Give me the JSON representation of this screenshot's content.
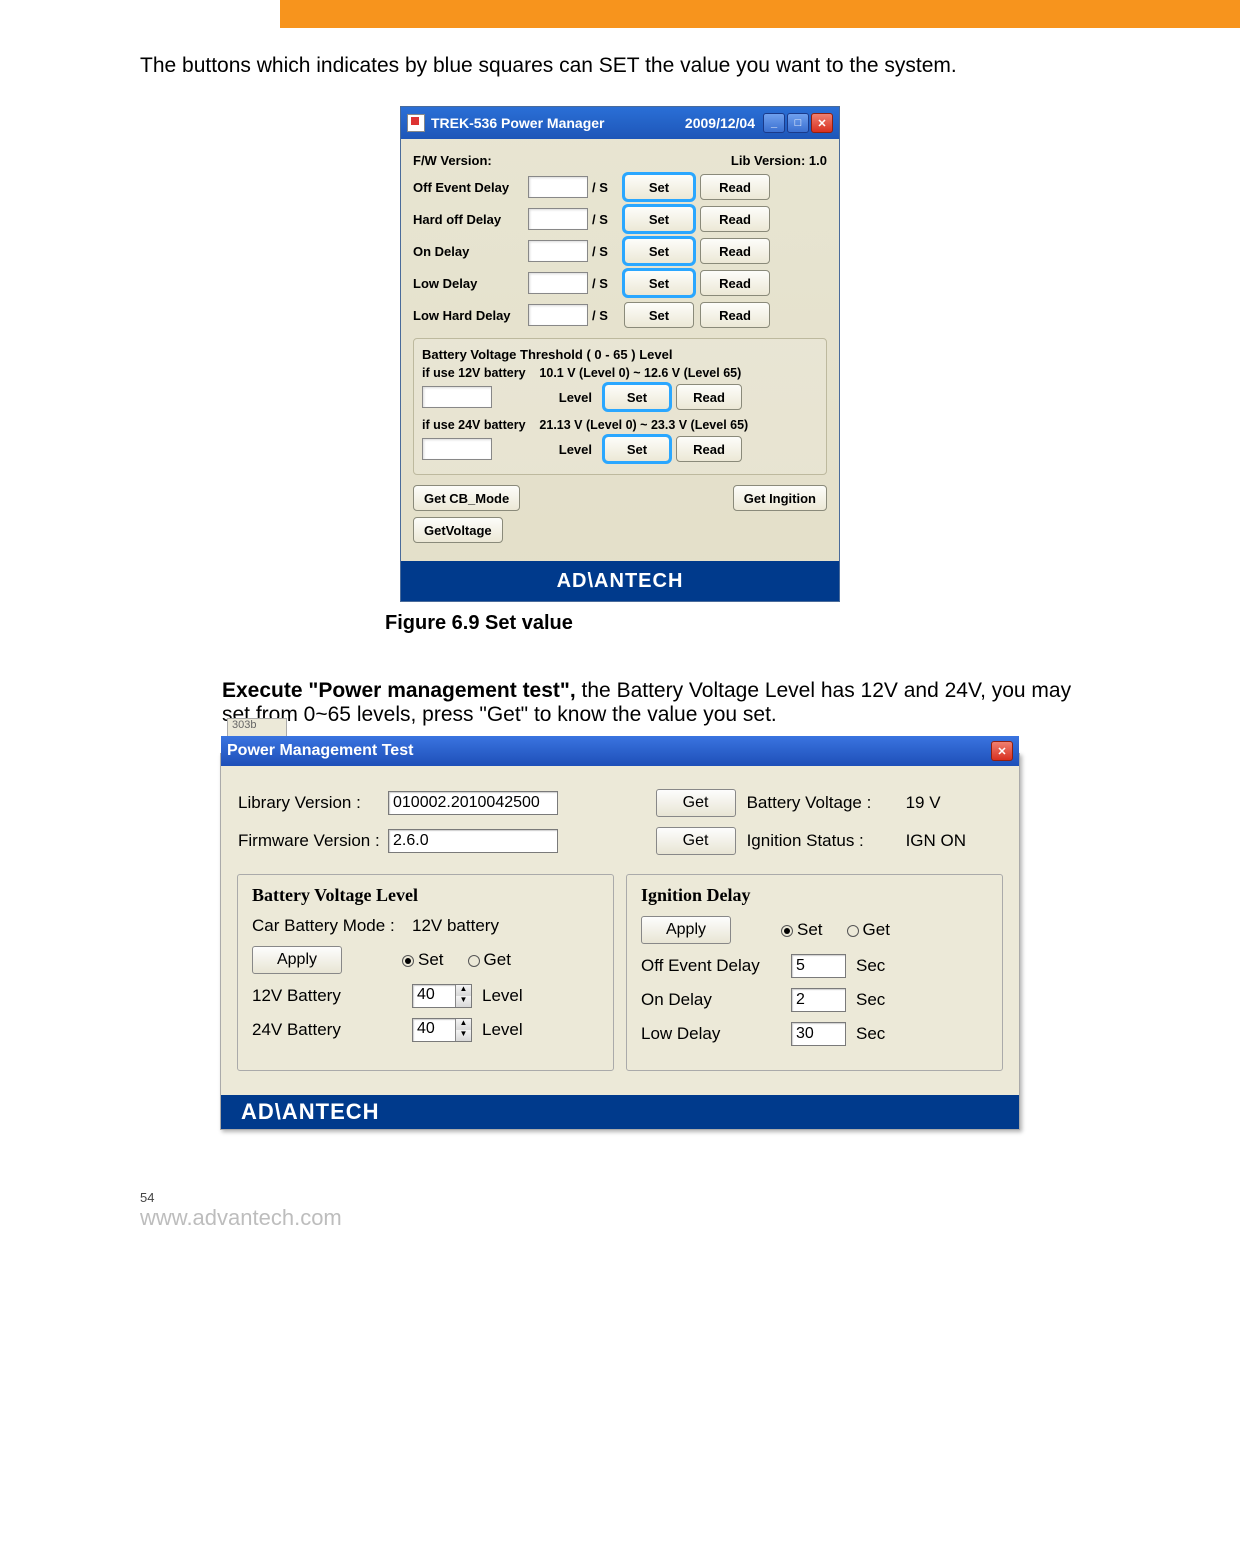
{
  "intro_text": "The buttons which indicates by blue squares can SET the value you want to the system.",
  "fig1": {
    "title": "TREK-536 Power Manager",
    "date": "2009/12/04",
    "fw_label": "F/W Version:",
    "lib_label": "Lib Version: 1.0",
    "rows": [
      {
        "label": "Off Event  Delay",
        "unit": "/ S",
        "set_hl": true
      },
      {
        "label": "Hard off  Delay",
        "unit": "/ S",
        "set_hl": true
      },
      {
        "label": "On  Delay",
        "unit": "/ S",
        "set_hl": true
      },
      {
        "label": "Low  Delay",
        "unit": "/ S",
        "set_hl": true
      },
      {
        "label": "Low Hard  Delay",
        "unit": "/ S",
        "set_hl": false
      }
    ],
    "set_label": "Set",
    "read_label": "Read",
    "group_title": "Battery Voltage Threshold  ( 0 - 65 ) Level",
    "g12_label": "if use 12V battery",
    "g12_range": "10.1 V (Level 0)  ~  12.6 V (Level 65)",
    "g24_label": "if use 24V battery",
    "g24_range": "21.13 V (Level 0)  ~  23.3 V (Level 65)",
    "level_label": "Level",
    "getcb": "Get CB_Mode",
    "getign": "Get Ingition",
    "getvolt": "GetVoltage",
    "logo": "AD\\ANTECH"
  },
  "caption1": "Figure 6.9 Set value",
  "para2_bold": "Execute \"Power management test\",",
  "para2_rest": " the Battery Voltage Level has 12V and 24V, you may set from 0~65 levels, press \"Get\" to know the value you set.",
  "fig2": {
    "tab": "303b",
    "title": "Power Management Test",
    "libver_lbl": "Library Version :",
    "libver_val": "010002.2010042500",
    "fwver_lbl": "Firmware Version :",
    "fwver_val": "2.6.0",
    "get": "Get",
    "batv_lbl": "Battery Voltage :",
    "batv_val": "19 V",
    "ign_lbl": "Ignition Status :",
    "ign_val": "IGN ON",
    "panelL": {
      "title": "Battery Voltage Level",
      "mode_lbl": "Car Battery Mode :",
      "mode_val": "12V battery",
      "apply": "Apply",
      "set": "Set",
      "get": "Get",
      "b12_lbl": "12V Battery",
      "b12_val": "40",
      "unit": "Level",
      "b24_lbl": "24V Battery",
      "b24_val": "40"
    },
    "panelR": {
      "title": "Ignition Delay",
      "apply": "Apply",
      "set": "Set",
      "get": "Get",
      "off_lbl": "Off Event Delay",
      "off_val": "5",
      "on_lbl": "On Delay",
      "on_val": "2",
      "low_lbl": "Low Delay",
      "low_val": "30",
      "unit": "Sec"
    },
    "logo": "AD\\ANTECH"
  },
  "page_num": "54",
  "url": "www.advantech.com"
}
